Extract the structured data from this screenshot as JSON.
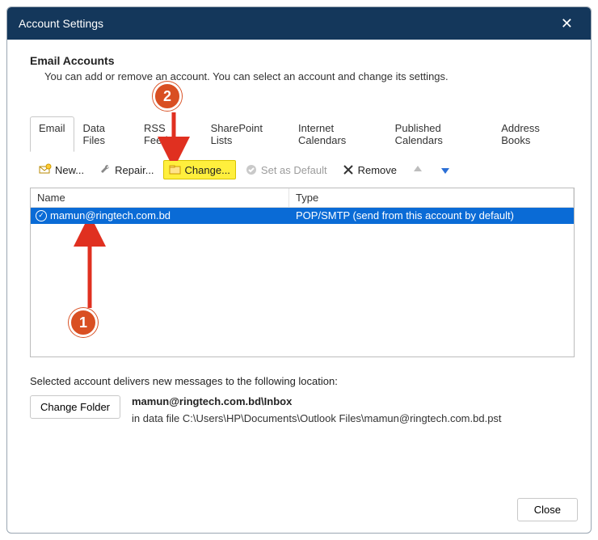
{
  "title": "Account Settings",
  "header": {
    "title": "Email Accounts",
    "subtitle": "You can add or remove an account. You can select an account and change its settings."
  },
  "tabs": [
    {
      "label": "Email",
      "active": true
    },
    {
      "label": "Data Files",
      "active": false
    },
    {
      "label": "RSS Feeds",
      "active": false
    },
    {
      "label": "SharePoint Lists",
      "active": false
    },
    {
      "label": "Internet Calendars",
      "active": false
    },
    {
      "label": "Published Calendars",
      "active": false
    },
    {
      "label": "Address Books",
      "active": false
    }
  ],
  "toolbar": {
    "new": "New...",
    "repair": "Repair...",
    "change": "Change...",
    "set_default": "Set as Default",
    "remove": "Remove"
  },
  "columns": {
    "name": "Name",
    "type": "Type"
  },
  "accounts": [
    {
      "name": "mamun@ringtech.com.bd",
      "type": "POP/SMTP (send from this account by default)",
      "default": true,
      "selected": true
    }
  ],
  "delivery": {
    "intro": "Selected account delivers new messages to the following location:",
    "change_folder": "Change Folder",
    "location_bold": "mamun@ringtech.com.bd\\Inbox",
    "datafile": "in data file C:\\Users\\HP\\Documents\\Outlook Files\\mamun@ringtech.com.bd.pst"
  },
  "close": "Close",
  "annotations": {
    "1": "1",
    "2": "2"
  }
}
